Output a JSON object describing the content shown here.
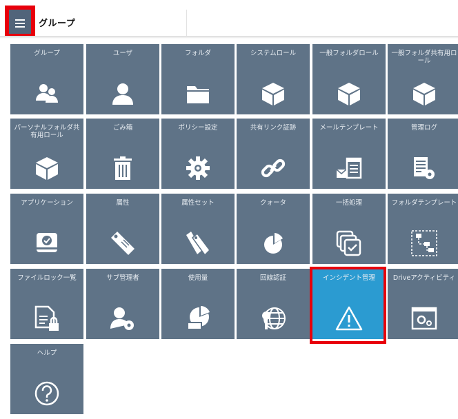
{
  "header": {
    "title": "グループ"
  },
  "tiles": [
    {
      "label": "グループ",
      "icon": "group-users-icon"
    },
    {
      "label": "ユーザ",
      "icon": "user-icon"
    },
    {
      "label": "フォルダ",
      "icon": "folder-icon"
    },
    {
      "label": "システムロール",
      "icon": "cube-icon"
    },
    {
      "label": "一般フォルダロール",
      "icon": "cube-icon"
    },
    {
      "label": "一般フォルダ共有用ロール",
      "icon": "cube-icon"
    },
    {
      "label": "パーソナルフォルダ共有用ロール",
      "icon": "cube-icon"
    },
    {
      "label": "ごみ箱",
      "icon": "trash-icon"
    },
    {
      "label": "ポリシー設定",
      "icon": "gear-icon"
    },
    {
      "label": "共有リンク証跡",
      "icon": "link-icon"
    },
    {
      "label": "メールテンプレート",
      "icon": "mail-template-icon"
    },
    {
      "label": "管理ログ",
      "icon": "log-settings-icon"
    },
    {
      "label": "アプリケーション",
      "icon": "app-drive-icon"
    },
    {
      "label": "属性",
      "icon": "tag-icon"
    },
    {
      "label": "属性セット",
      "icon": "tags-icon"
    },
    {
      "label": "クォータ",
      "icon": "pie-icon"
    },
    {
      "label": "一括処理",
      "icon": "batch-icon"
    },
    {
      "label": "フォルダテンプレート",
      "icon": "folder-template-icon"
    },
    {
      "label": "ファイルロック一覧",
      "icon": "file-lock-icon"
    },
    {
      "label": "サブ管理者",
      "icon": "sub-admin-icon"
    },
    {
      "label": "使用量",
      "icon": "usage-icon"
    },
    {
      "label": "回線認証",
      "icon": "globe-key-icon"
    },
    {
      "label": "インシデント管理",
      "icon": "warning-icon",
      "selected": true
    },
    {
      "label": "Driveアクティビティ",
      "icon": "drive-activity-icon"
    },
    {
      "label": "ヘルプ",
      "icon": "help-icon"
    }
  ]
}
